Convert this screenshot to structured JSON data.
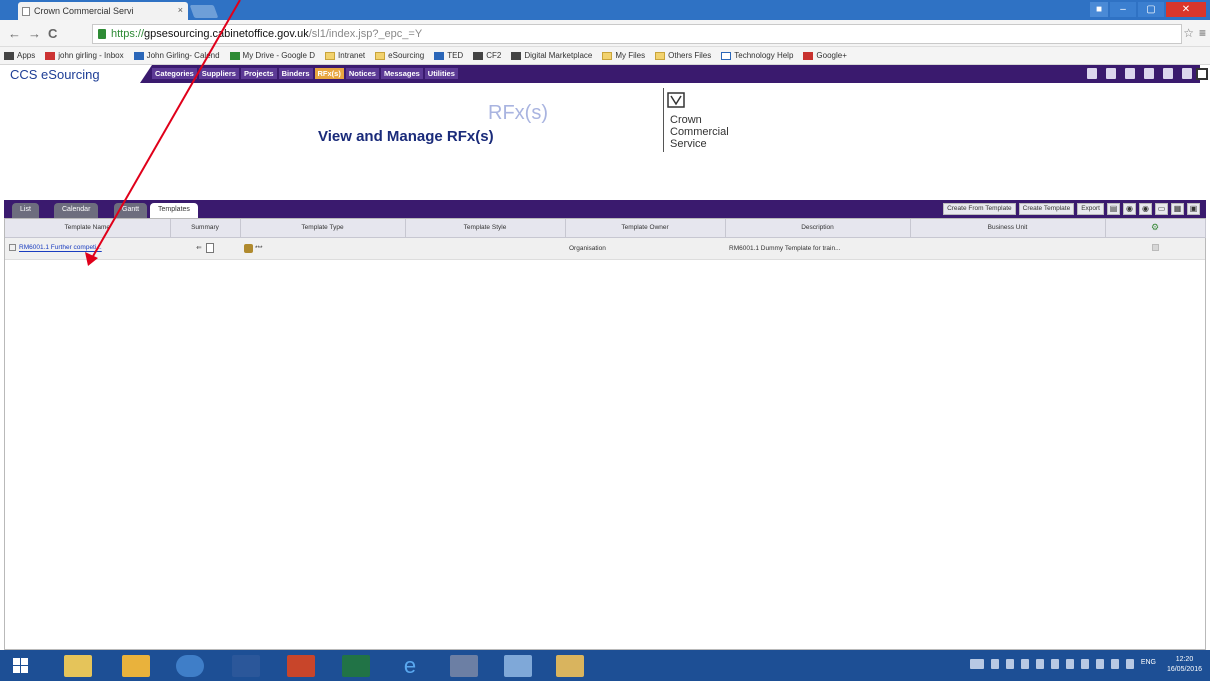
{
  "browser": {
    "tab_title": "Crown Commercial Servi",
    "tab_close": "×",
    "address": {
      "https": "https://",
      "host": "gpsesourcing.cabinetoffice.gov.uk",
      "rest": "/sl1/index.jsp?_epc_=Y"
    },
    "bookmarks": [
      "Apps",
      "john girling - Inbox",
      "John Girling- Calend",
      "My Drive - Google D",
      "Intranet",
      "eSourcing",
      "TED",
      "CF2",
      "Digital Marketplace",
      "My Files",
      "Others Files",
      "Technology Help",
      "Google+"
    ]
  },
  "app": {
    "brand": "CCS eSourcing",
    "nav": [
      "Categories",
      "Suppliers",
      "Projects",
      "Binders",
      "RFx(s)",
      "Notices",
      "Messages",
      "Utilities"
    ],
    "active_nav": "RFx(s)"
  },
  "heading": {
    "watermark": "RFx(s)",
    "title": "View and Manage RFx(s)",
    "org_line1": "Crown",
    "org_line2": "Commercial",
    "org_line3": "Service"
  },
  "tabs": [
    "List",
    "Calendar",
    "Gantt",
    "Templates"
  ],
  "active_tab": "Templates",
  "toolbar": [
    "Create From Template",
    "Create Template",
    "Export"
  ],
  "table": {
    "columns": [
      "Template Name",
      "Summary",
      "Template Type",
      "Template Style",
      "Template Owner",
      "Description",
      "Business Unit",
      ""
    ],
    "rows": [
      {
        "name": "RM6001.1 Further competi...",
        "type": "***",
        "style": "",
        "owner": "Organisation",
        "description": "RM6001.1 Dummy Template for train...",
        "business_unit": ""
      }
    ]
  },
  "taskbar": {
    "tray_lang": "ENG",
    "time": "12:20",
    "date": "16/05/2016"
  }
}
